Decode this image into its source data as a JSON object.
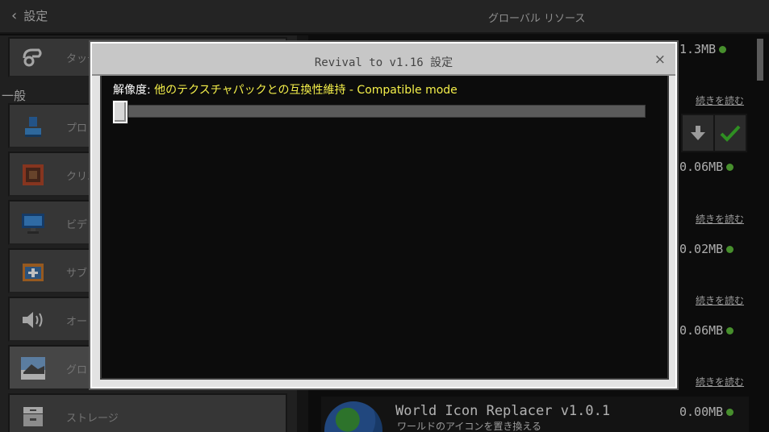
{
  "header": {
    "back_label": "設定",
    "title": "グローバル リソース"
  },
  "sidebar": {
    "section_label": "一般",
    "items": [
      {
        "label": "タッチ",
        "icon": "touch-icon"
      },
      {
        "label": "プロ",
        "icon": "profile-icon"
      },
      {
        "label": "クリエ",
        "icon": "creator-icon"
      },
      {
        "label": "ビデ",
        "icon": "video-icon"
      },
      {
        "label": "サブ",
        "icon": "subscription-icon"
      },
      {
        "label": "オー",
        "icon": "audio-icon"
      },
      {
        "label": "グロ",
        "icon": "global-resources-icon"
      },
      {
        "label": "ストレージ",
        "icon": "storage-icon"
      }
    ]
  },
  "packs": {
    "sizes": [
      "1.3MB",
      "0.06MB",
      "0.02MB",
      "0.06MB",
      "0.00MB"
    ],
    "read_more": "続きを読む",
    "last_pack": {
      "name": "World Icon Replacer v1.0.1",
      "description": "ワールドのアイコンを置き換える"
    }
  },
  "modal": {
    "title": "Revival to v1.16 設定",
    "close_glyph": "×",
    "setting": {
      "key": "解像度: ",
      "value": "他のテクスチャパックとの互換性維持 - Compatible mode",
      "slider_position": 0
    }
  },
  "colors": {
    "accent_yellow": "#f5f04a",
    "status_green": "#5fbf3c"
  }
}
